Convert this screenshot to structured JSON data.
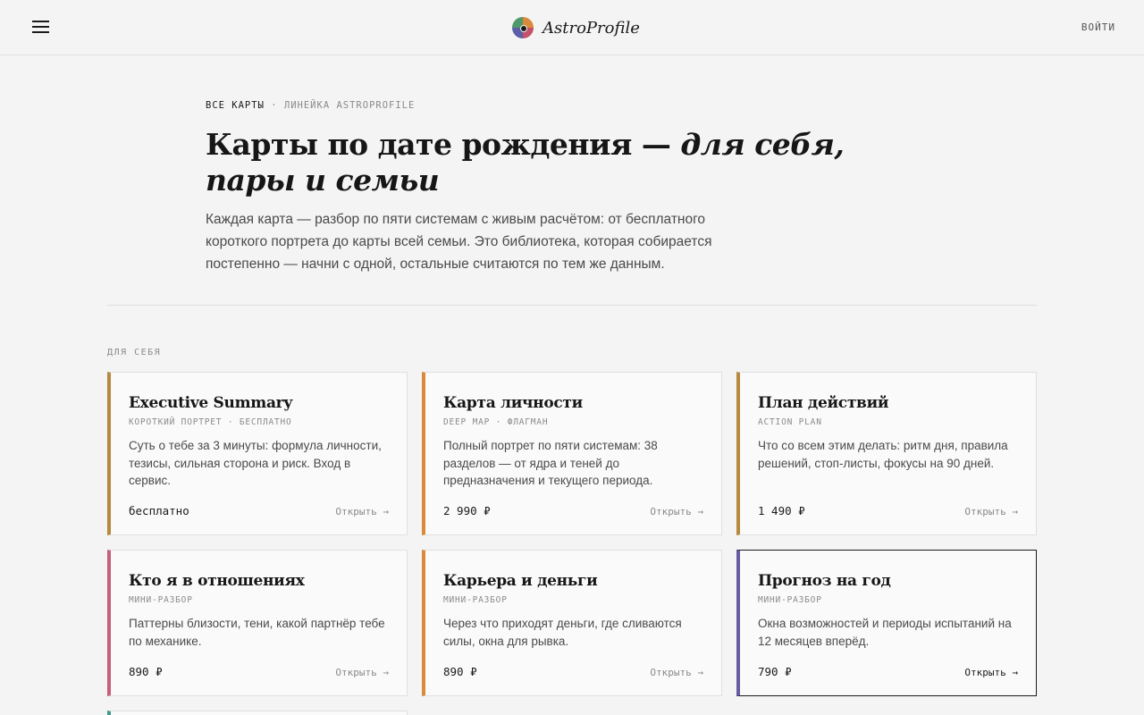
{
  "header": {
    "menu_icon": "hamburger-icon",
    "logo_icon": "astro-wheel-icon",
    "brand": "AstroProfile",
    "login_label": "ВОЙТИ"
  },
  "breadcrumb": {
    "current": "ВСЕ КАРТЫ",
    "separator": "·",
    "parent": "ЛИНЕЙКА ASTROPROFILE"
  },
  "hero": {
    "title_plain": "Карты по дате рождения — ",
    "title_italic": "для себя, пары и семьи",
    "lead": "Каждая карта — разбор по пяти системам с живым расчётом: от бесплатного короткого портрета до карты всей семьи. Это библиотека, которая собирается постепенно — начни с одной, остальные считаются по тем же данным."
  },
  "section_label": "ДЛЯ СЕБЯ",
  "cards": [
    {
      "name": "Executive Summary",
      "sub": "КОРОТКИЙ ПОРТРЕТ · БЕСПЛАТНО",
      "desc": "Суть о тебе за 3 минуты: формула личности, тезисы, сильная сторона и риск. Вход в сервис.",
      "price": "бесплатно",
      "open": "Открыть →",
      "accent": "#b68a3e"
    },
    {
      "name": "Карта личности",
      "sub": "DEEP MAP · ФЛАГМАН",
      "desc": "Полный портрет по пяти системам: 38 разделов — от ядра и теней до предназначения и текущего периода.",
      "price": "2 990 ₽",
      "open": "Открыть →",
      "accent": "#d98a3a"
    },
    {
      "name": "План действий",
      "sub": "ACTION PLAN",
      "desc": "Что со всем этим делать: ритм дня, правила решений, стоп-листы, фокусы на 90 дней.",
      "price": "1 490 ₽",
      "open": "Открыть →",
      "accent": "#b68a3e"
    },
    {
      "name": "Кто я в отношениях",
      "sub": "МИНИ-РАЗБОР",
      "desc": "Паттерны близости, тени, какой партнёр тебе по механике.",
      "price": "890 ₽",
      "open": "Открыть →",
      "accent": "#c4607a"
    },
    {
      "name": "Карьера и деньги",
      "sub": "МИНИ-РАЗБОР",
      "desc": "Через что приходят деньги, где сливаются силы, окна для рывка.",
      "price": "890 ₽",
      "open": "Открыть →",
      "accent": "#d98a3a"
    },
    {
      "name": "Прогноз на год",
      "sub": "МИНИ-РАЗБОР",
      "desc": "Окна возможностей и периоды испытаний на 12 месяцев вперёд.",
      "price": "790 ₽",
      "open": "Открыть →",
      "accent": "#6a5aa0"
    }
  ]
}
